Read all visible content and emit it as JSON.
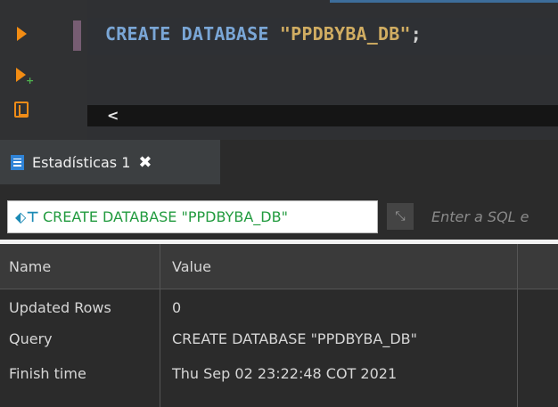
{
  "editor": {
    "keyword": "CREATE DATABASE",
    "string": "\"PPDBYBA_DB\"",
    "terminator": ";",
    "hscroll_left": "<"
  },
  "tab": {
    "label": "Estadísticas 1",
    "close": "✖"
  },
  "query_bar": {
    "query_text": "CREATE DATABASE \"PPDBYBA_DB\"",
    "filter_placeholder": "Enter a SQL e"
  },
  "grid": {
    "headers": [
      "Name",
      "Value"
    ],
    "rows": [
      {
        "name": "Updated Rows",
        "value": "0"
      },
      {
        "name": "Query",
        "value": "CREATE DATABASE \"PPDBYBA_DB\""
      },
      {
        "name": "Finish time",
        "value": "Thu Sep 02 23:22:48 COT 2021"
      }
    ]
  },
  "colors": {
    "keyword": "#7aa6d6",
    "string": "#d1ad62",
    "query": "#229b3f",
    "accent_orange": "#f28c13"
  },
  "icons": [
    "execute-statement-icon",
    "execute-new-tab-icon",
    "execute-script-icon",
    "statistics-icon",
    "close-icon",
    "sql-query-icon",
    "expand-icon"
  ]
}
